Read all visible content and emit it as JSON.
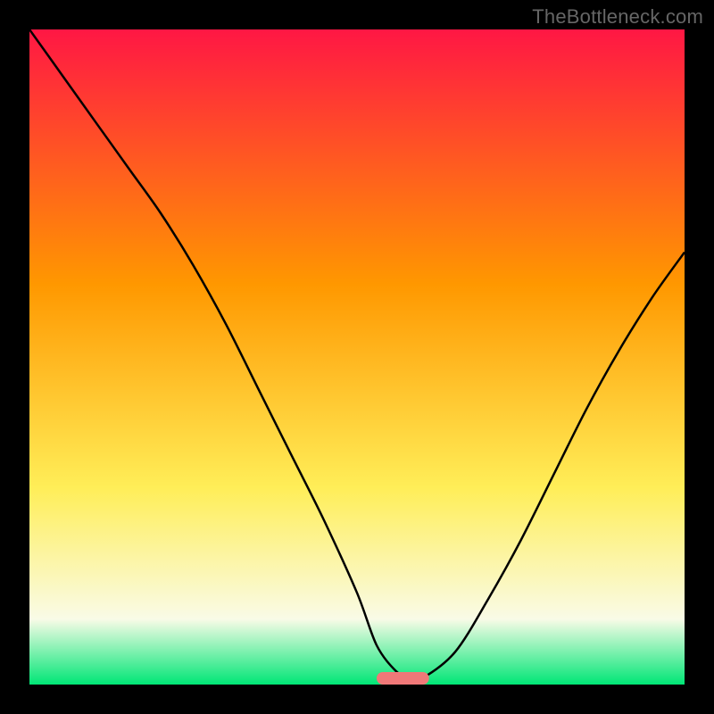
{
  "watermark": "TheBottleneck.com",
  "chart_data": {
    "type": "line",
    "title": "",
    "xlabel": "",
    "ylabel": "",
    "xlim": [
      0,
      100
    ],
    "ylim": [
      0,
      100
    ],
    "background_gradient_colors": [
      "#ff1744",
      "#ff9800",
      "#ffee58",
      "#f9fbe7",
      "#00e676"
    ],
    "series": [
      {
        "name": "bottleneck-curve",
        "x": [
          0,
          5,
          10,
          15,
          20,
          25,
          30,
          35,
          40,
          45,
          50,
          53,
          56,
          58,
          60,
          65,
          70,
          75,
          80,
          85,
          90,
          95,
          100
        ],
        "y": [
          100,
          93,
          86,
          79,
          72,
          64,
          55,
          45,
          35,
          25,
          14,
          6,
          2,
          1,
          1,
          5,
          13,
          22,
          32,
          42,
          51,
          59,
          66
        ]
      }
    ],
    "marker": {
      "name": "optimal-zone-pill",
      "x_center": 57,
      "width": 8,
      "color": "#f07878"
    }
  }
}
